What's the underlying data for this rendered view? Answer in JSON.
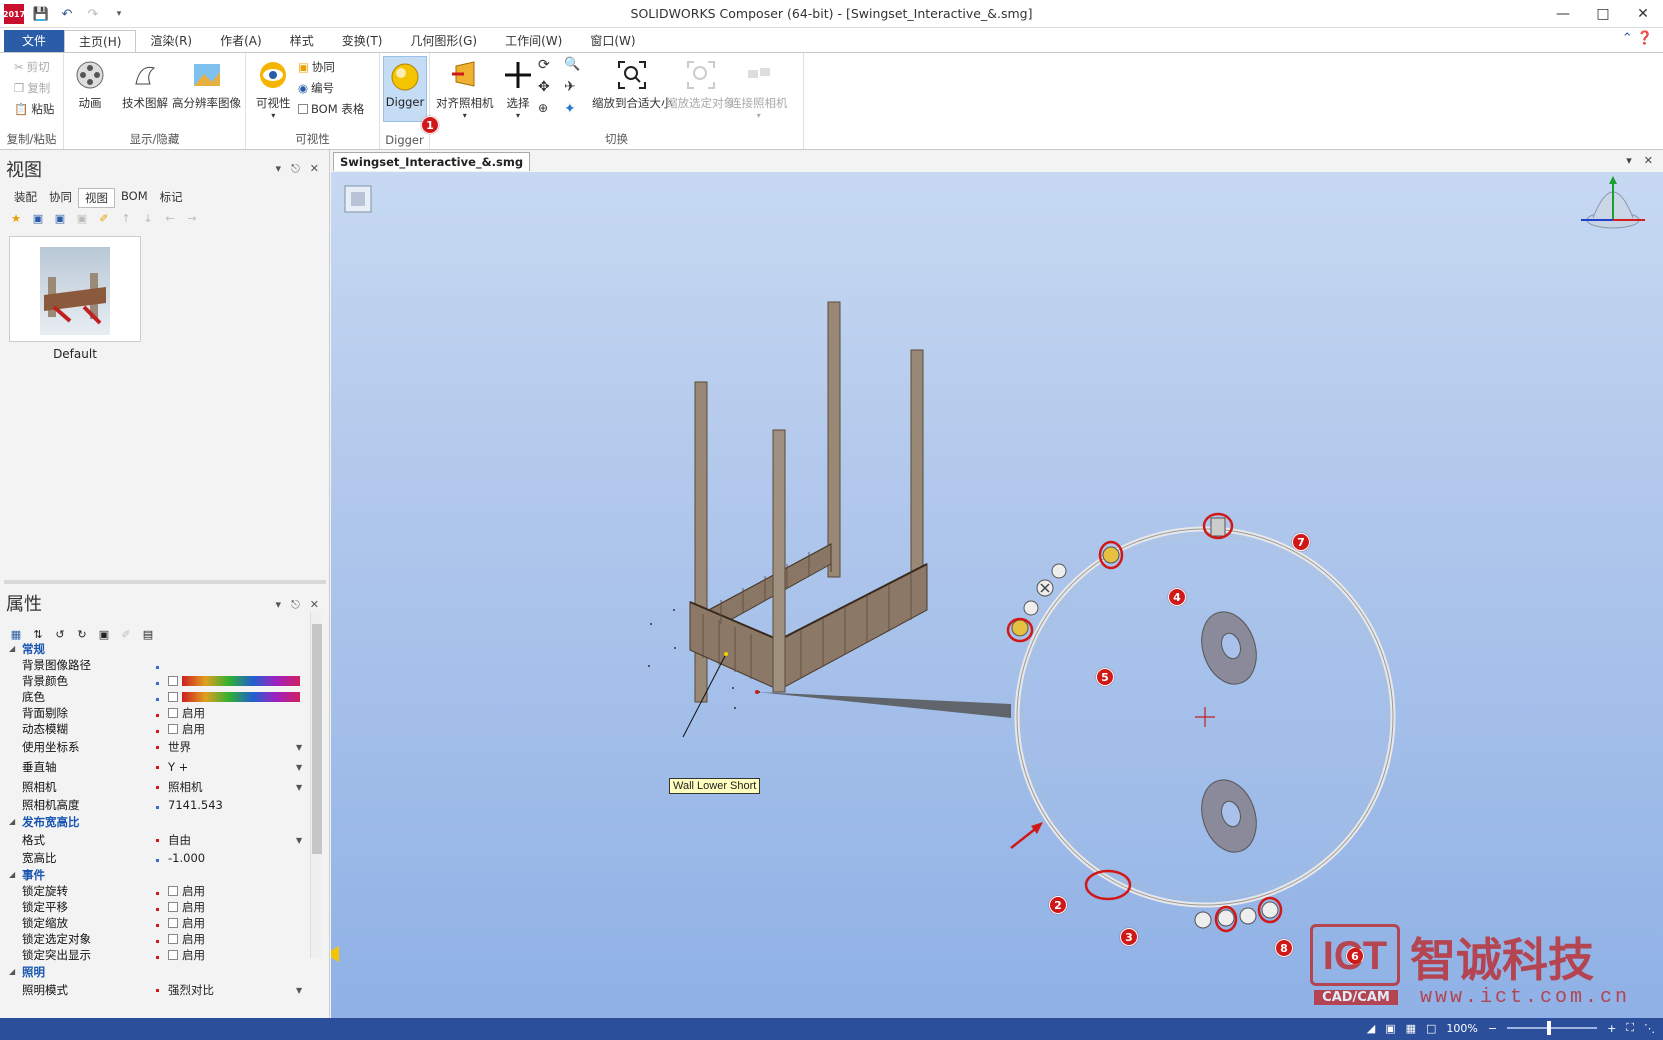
{
  "window": {
    "title": "SOLIDWORKS Composer (64-bit) - [Swingset_Interactive_&.smg]",
    "app_badge": "2017"
  },
  "menu": {
    "file": "文件",
    "items": [
      "主页(H)",
      "渲染(R)",
      "作者(A)",
      "样式",
      "变换(T)",
      "几何图形(G)",
      "工作间(W)",
      "窗口(W)"
    ]
  },
  "ribbon": {
    "clipboard": {
      "cut": "剪切",
      "copy": "复制",
      "paste": "粘贴",
      "label": "复制/粘贴"
    },
    "show_hide": {
      "animation": "动画",
      "tech": "技术图解",
      "hires": "高分辨率图像",
      "label": "显示/隐藏"
    },
    "visibility": {
      "visibility": "可视性",
      "collab": "协同",
      "numbering": "编号",
      "bom_table": "BOM 表格",
      "label": "可视性"
    },
    "digger": {
      "button": "Digger",
      "label": "Digger"
    },
    "switch": {
      "align_camera": "对齐照相机",
      "select": "选择",
      "zoom_fit": "缩放到合适大小",
      "zoom_sel": "缩放选定对象",
      "link_camera": "连接照相机",
      "label": "切换"
    }
  },
  "views_panel": {
    "title": "视图",
    "tabs": [
      "装配",
      "协同",
      "视图",
      "BOM",
      "标记"
    ],
    "thumb_label": "Default"
  },
  "props_panel": {
    "title": "属性",
    "rows": [
      {
        "type": "cat",
        "name": "常规"
      },
      {
        "type": "prop",
        "name": "背景图像路径",
        "value": ""
      },
      {
        "type": "prop",
        "name": "背景颜色",
        "value": "",
        "swatch": "spectrum"
      },
      {
        "type": "prop",
        "name": "底色",
        "value": "",
        "swatch": "spectrum2"
      },
      {
        "type": "prop",
        "name": "背面剔除",
        "value": "启用",
        "check": true
      },
      {
        "type": "prop",
        "name": "动态模糊",
        "value": "启用",
        "check": true
      },
      {
        "type": "prop",
        "name": "使用坐标系",
        "value": "世界",
        "dd": true
      },
      {
        "type": "prop",
        "name": "垂直轴",
        "value": "Y +",
        "dd": true
      },
      {
        "type": "prop",
        "name": "照相机",
        "value": "照相机",
        "dd": true
      },
      {
        "type": "prop",
        "name": "照相机高度",
        "value": "7141.543"
      },
      {
        "type": "cat",
        "name": "发布宽高比"
      },
      {
        "type": "prop",
        "name": "格式",
        "value": "自由",
        "dd": true
      },
      {
        "type": "prop",
        "name": "宽高比",
        "value": "-1.000"
      },
      {
        "type": "cat",
        "name": "事件"
      },
      {
        "type": "prop",
        "name": "锁定旋转",
        "value": "启用",
        "check": true
      },
      {
        "type": "prop",
        "name": "锁定平移",
        "value": "启用",
        "check": true
      },
      {
        "type": "prop",
        "name": "锁定缩放",
        "value": "启用",
        "check": true
      },
      {
        "type": "prop",
        "name": "锁定选定对象",
        "value": "启用",
        "check": true
      },
      {
        "type": "prop",
        "name": "锁定突出显示",
        "value": "启用",
        "check": true
      },
      {
        "type": "cat",
        "name": "照明"
      },
      {
        "type": "prop",
        "name": "照明模式",
        "value": "强烈对比",
        "dd": true
      }
    ]
  },
  "document": {
    "tab": "Swingset_Interactive_&.smg",
    "callout": "Wall Lower Short"
  },
  "markers": [
    "1",
    "2",
    "3",
    "4",
    "5",
    "6",
    "7",
    "8"
  ],
  "status": {
    "zoom": "100%"
  },
  "watermark": {
    "brand": "智诚科技",
    "sub": "CAD/CAM",
    "url": "www.ict.com.cn",
    "logo": "ICT"
  }
}
